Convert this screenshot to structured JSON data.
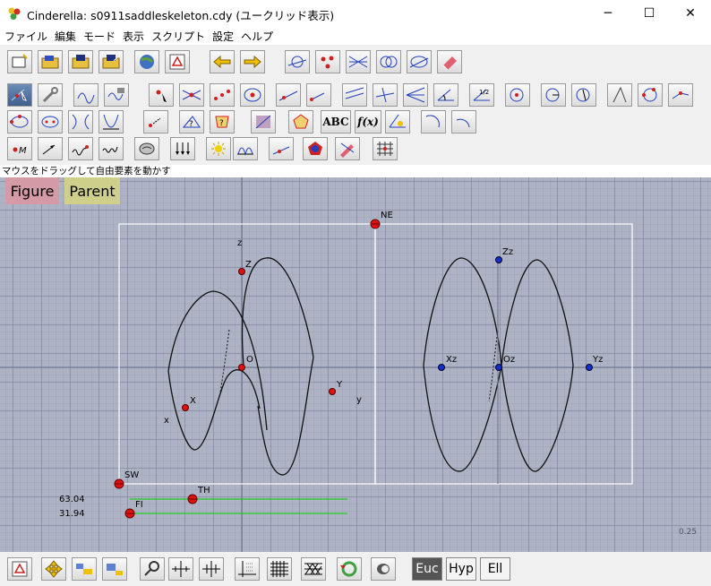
{
  "window": {
    "title": "Cinderella: s0911saddleskeleton.cdy (ユークリッド表示)",
    "minimize": "─",
    "maximize": "☐",
    "close": "✕"
  },
  "menu": [
    "ファイル",
    "編集",
    "モード",
    "表示",
    "スクリプト",
    "設定",
    "ヘルプ"
  ],
  "toolbar": {
    "text_label": "ABC",
    "function_label": "f(x)"
  },
  "status": "マウスをドラッグして自由要素を動かす",
  "tabs": {
    "figure": "Figure",
    "parent": "Parent"
  },
  "points": {
    "NE": "NE",
    "SW": "SW",
    "TH": "TH",
    "FI": "FI",
    "X": "X",
    "Y": "Y",
    "Z": "Z",
    "O": "O",
    "Xz": "Xz",
    "Yz": "Yz",
    "Zz": "Zz",
    "Oz": "Oz"
  },
  "axis_labels": {
    "x": "x",
    "y": "y",
    "z": "z"
  },
  "values": {
    "theta": "63.04",
    "phi": "31.94"
  },
  "zoom_level": "0.25",
  "geometry_buttons": {
    "euclidean": "Euc",
    "hyperbolic": "Hyp",
    "elliptic": "Ell"
  },
  "colors": {
    "canvas_bg": "#adb3c4",
    "point_red": "#e01010",
    "point_blue": "#1030d0",
    "slider_green": "#22cc22",
    "figure_tab": "#d49aa6",
    "parent_tab": "#cfcf8c"
  }
}
